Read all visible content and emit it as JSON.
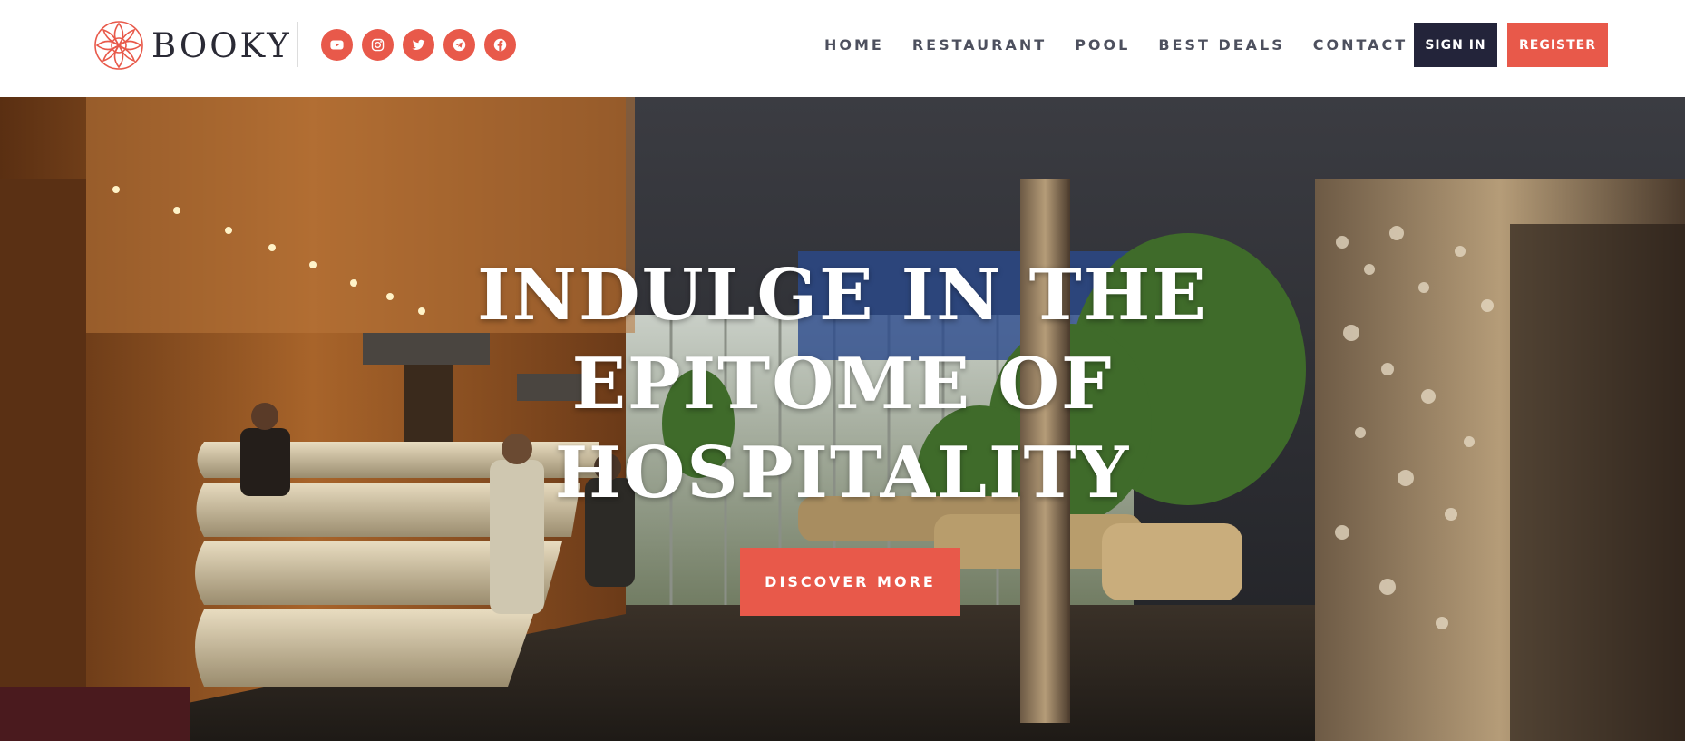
{
  "brand": {
    "name": "BOOKY"
  },
  "socials": [
    {
      "icon": "youtube-icon"
    },
    {
      "icon": "instagram-icon"
    },
    {
      "icon": "twitter-icon"
    },
    {
      "icon": "telegram-icon"
    },
    {
      "icon": "facebook-icon"
    }
  ],
  "nav": {
    "items": [
      "HOME",
      "RESTAURANT",
      "POOL",
      "BEST DEALS",
      "CONTACT"
    ]
  },
  "auth": {
    "signin_label": "SIGN IN",
    "register_label": "REGISTER"
  },
  "hero": {
    "headline": [
      "INDULGE IN THE",
      "EPITOME OF",
      "HOSPITALITY"
    ],
    "cta_label": "DISCOVER MORE"
  },
  "colors": {
    "accent": "#e8594a",
    "dark": "#23243a",
    "nav_text": "#2f3242"
  }
}
